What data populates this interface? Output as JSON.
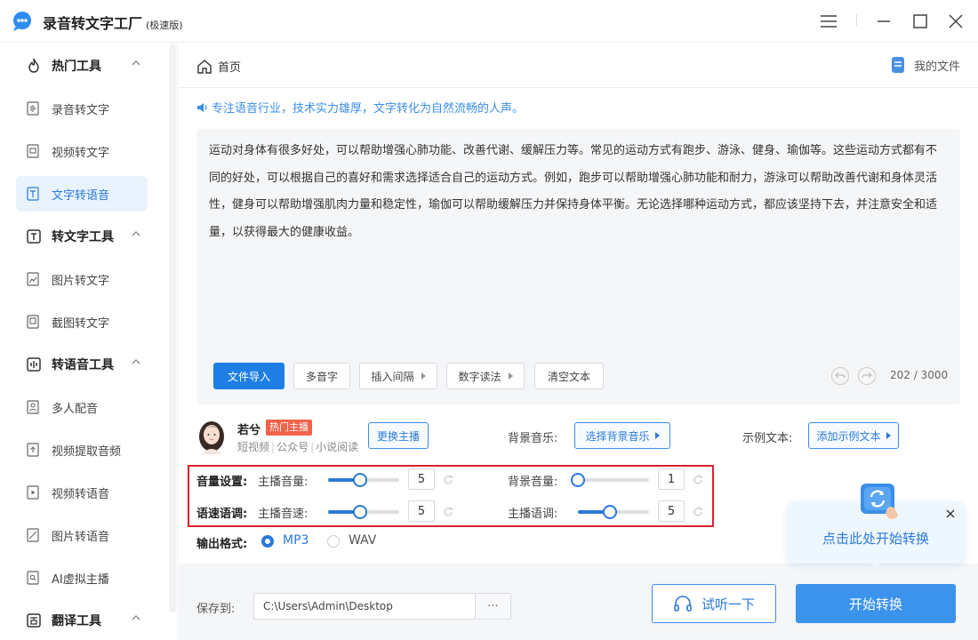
{
  "app": {
    "title": "录音转文字工厂",
    "edition": "(极速版)"
  },
  "sidebar": {
    "groups": [
      {
        "label": "热门工具",
        "icon": "flame-icon"
      },
      {
        "label": "转文字工具",
        "icon": "text-t-icon"
      },
      {
        "label": "转语音工具",
        "icon": "waveform-icon"
      },
      {
        "label": "翻译工具",
        "icon": "translate-icon"
      }
    ],
    "items": [
      {
        "label": "录音转文字",
        "icon": "audio-file-icon"
      },
      {
        "label": "视频转文字",
        "icon": "video-file-icon"
      },
      {
        "label": "文字转语音",
        "icon": "text-file-icon",
        "active": true
      },
      {
        "label": "图片转文字",
        "icon": "image-file-icon"
      },
      {
        "label": "截图转文字",
        "icon": "screenshot-icon"
      },
      {
        "label": "多人配音",
        "icon": "person-icon"
      },
      {
        "label": "视频提取音频",
        "icon": "extract-icon"
      },
      {
        "label": "视频转语音",
        "icon": "play-file-icon"
      },
      {
        "label": "图片转语音",
        "icon": "picture-icon"
      },
      {
        "label": "AI虚拟主播",
        "icon": "search-file-icon"
      }
    ]
  },
  "topbar": {
    "home_label": "首页",
    "my_files_label": "我的文件"
  },
  "notice": "专注语音行业，技术实力雄厚，文字转化为自然流畅的人声。",
  "editor": {
    "text": "运动对身体有很多好处，可以帮助增强心肺功能、改善代谢、缓解压力等。常见的运动方式有跑步、游泳、健身、瑜伽等。这些运动方式都有不同的好处，可以根据自己的喜好和需求选择适合自己的运动方式。例如，跑步可以帮助增强心肺功能和耐力，游泳可以帮助改善代谢和身体灵活性，健身可以帮助增强肌肉力量和稳定性，瑜伽可以帮助缓解压力并保持身体平衡。无论选择哪种运动方式，都应该坚持下去，并注意安全和适量，以获得最大的健康收益。",
    "buttons": {
      "import": "文件导入",
      "polyphone": "多音字",
      "insert_pause": "插入间隔",
      "number_reading": "数字读法",
      "clear": "清空文本"
    },
    "counter": "202 / 3000"
  },
  "voice": {
    "name": "若兮",
    "badge": "热门主播",
    "tags": [
      "短视频",
      "公众号",
      "小说阅读"
    ],
    "change_button": "更换主播",
    "bg_music_label": "背景音乐:",
    "bg_music_button": "选择背景音乐",
    "sample_label": "示例文本:",
    "sample_button": "添加示例文本"
  },
  "settings": {
    "volume_title": "音量设置:",
    "speed_title": "语速语调:",
    "anchor_volume": {
      "label": "主播音量:",
      "value": "5",
      "fraction": 0.45
    },
    "bg_volume": {
      "label": "背景音量:",
      "value": "1",
      "fraction": 0.0
    },
    "anchor_speed": {
      "label": "主播音速:",
      "value": "5",
      "fraction": 0.45
    },
    "anchor_pitch": {
      "label": "主播语调:",
      "value": "5",
      "fraction": 0.45
    }
  },
  "output": {
    "label": "输出格式:",
    "options": [
      "MP3",
      "WAV"
    ],
    "selected": "MP3"
  },
  "bottom": {
    "save_label": "保存到:",
    "save_path": "C:\\Users\\Admin\\Desktop",
    "more": "···",
    "listen_button": "试听一下",
    "start_button": "开始转换"
  },
  "tip": {
    "text": "点击此处开始转换"
  },
  "colors": {
    "accent": "#2a7ad8",
    "primary_button": "#1f7ee3",
    "badge": "#f0634a",
    "highlight_border": "#d8232a",
    "active_bg": "#e8f3fe"
  }
}
